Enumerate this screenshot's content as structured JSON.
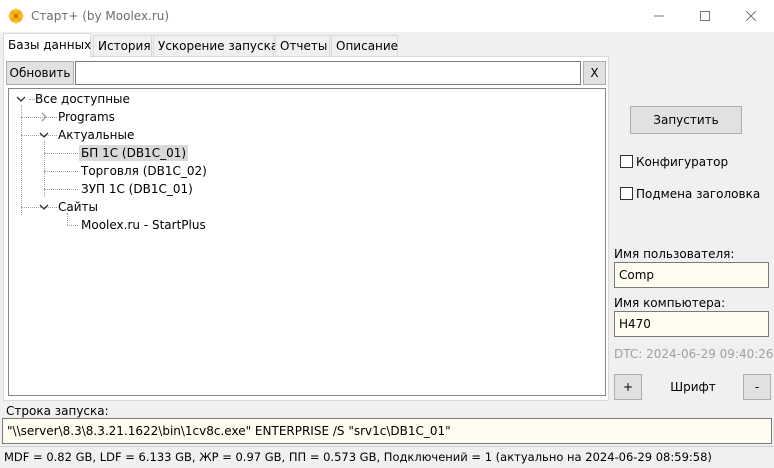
{
  "window": {
    "title": "Старт+ (by Moolex.ru)",
    "icon": "flower-app-icon",
    "accent_color": "#f2b400"
  },
  "tabs": [
    {
      "label": "Базы данных",
      "active": true
    },
    {
      "label": "История",
      "active": false
    },
    {
      "label": "Ускорение запуска",
      "active": false
    },
    {
      "label": "Отчеты",
      "active": false
    },
    {
      "label": "Описание",
      "active": false
    }
  ],
  "toolbar": {
    "refresh_label": "Обновить",
    "search_value": "",
    "clear_label": "X"
  },
  "tree": {
    "root": {
      "label": "Все доступные",
      "expanded": true
    },
    "items": [
      {
        "label": "Programs",
        "expanded": false
      },
      {
        "label": "Актуальные",
        "expanded": true
      },
      {
        "label": "БП 1С (DB1C_01)",
        "selected": true
      },
      {
        "label": "Торговля (DB1C_02)",
        "selected": false
      },
      {
        "label": "ЗУП 1С (DB1C_01)",
        "selected": false
      },
      {
        "label": "Сайты",
        "expanded": true
      },
      {
        "label": "Moolex.ru - StartPlus",
        "selected": false
      }
    ]
  },
  "side": {
    "launch_label": "Запустить",
    "configurator_label": "Конфигуратор",
    "configurator_checked": false,
    "title_replace_label": "Подмена заголовка",
    "title_replace_checked": false,
    "username_label": "Имя пользователя:",
    "username_value": "Comp",
    "computer_label": "Имя компьютера:",
    "computer_value": "H470",
    "dtc": "DTC: 2024-06-29 09:40:26",
    "font_plus": "+",
    "font_label": "Шрифт",
    "font_minus": "-"
  },
  "command": {
    "label": "Строка запуска:",
    "value": "\"\\\\server\\8.3\\8.3.21.1622\\bin\\1cv8c.exe\" ENTERPRISE /S \"srv1c\\DB1C_01\""
  },
  "status_bar": "MDF = 0.82 GB,  LDF = 6.133 GB, ЖР = 0.97 GB, ПП = 0.573 GB, Подключений = 1 (актуально на 2024-06-29 08:59:58)"
}
